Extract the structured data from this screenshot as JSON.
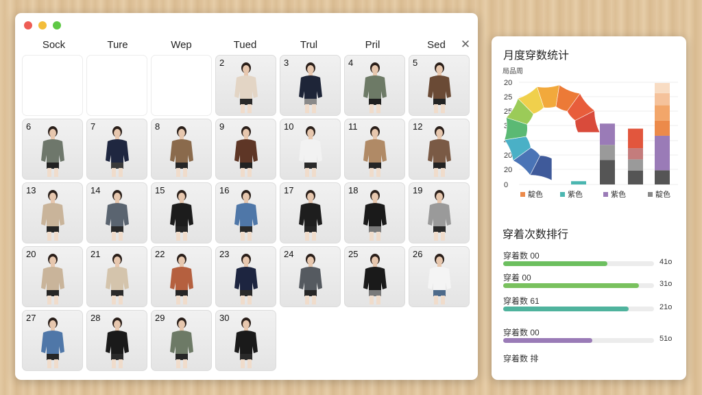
{
  "calendar": {
    "weekday_headers": [
      "Sock",
      "Ture",
      "Wep",
      "Tued",
      "Trul",
      "Pril",
      "Sed"
    ],
    "days": [
      {
        "day": "",
        "outfit": null
      },
      {
        "day": "",
        "outfit": null
      },
      {
        "day": "",
        "outfit": null
      },
      {
        "day": "2",
        "outfit": {
          "top": "#e3d5c5",
          "bottom": "#2a2a2a",
          "legs": "#f0dccb",
          "hair": "#2a1f1a"
        }
      },
      {
        "day": "3",
        "outfit": {
          "top": "#1e2538",
          "bottom": "#8a8a8a",
          "legs": "#f0dccb",
          "hair": "#2a1f1a"
        }
      },
      {
        "day": "4",
        "outfit": {
          "top": "#6d7a66",
          "bottom": "#1f1f1f",
          "legs": "#f0dccb",
          "hair": "#2a1f1a"
        }
      },
      {
        "day": "5",
        "outfit": {
          "top": "#6a4a35",
          "bottom": "#232323",
          "legs": "#f0dccb",
          "hair": "#2a1f1a"
        }
      },
      {
        "day": "6",
        "outfit": {
          "top": "#6e776b",
          "bottom": "#222222",
          "legs": "#f0dccb",
          "hair": "#2a1f1a"
        }
      },
      {
        "day": "7",
        "outfit": {
          "top": "#1f2740",
          "bottom": "#3a3a3a",
          "legs": "#f0dccb",
          "hair": "#2a1f1a"
        }
      },
      {
        "day": "8",
        "outfit": {
          "top": "#8a6a4c",
          "bottom": "#262626",
          "legs": "#f0dccb",
          "hair": "#2a1f1a"
        }
      },
      {
        "day": "9",
        "outfit": {
          "top": "#5e3626",
          "bottom": "#222222",
          "legs": "#f0dccb",
          "hair": "#2a1f1a"
        }
      },
      {
        "day": "10",
        "outfit": {
          "top": "#f2f2f2",
          "bottom": "#2a2a2a",
          "legs": "#f0dccb",
          "hair": "#2a1f1a"
        }
      },
      {
        "day": "11",
        "outfit": {
          "top": "#b08a66",
          "bottom": "#262626",
          "legs": "#f0dccb",
          "hair": "#2a1f1a"
        }
      },
      {
        "day": "12",
        "outfit": {
          "top": "#7a5a45",
          "bottom": "#222222",
          "legs": "#f0dccb",
          "hair": "#2a1f1a"
        }
      },
      {
        "day": "13",
        "outfit": {
          "top": "#c9b49a",
          "bottom": "#262626",
          "legs": "#f0dccb",
          "hair": "#2a1f1a"
        }
      },
      {
        "day": "14",
        "outfit": {
          "top": "#5a6470",
          "bottom": "#2a2a2a",
          "legs": "#f0dccb",
          "hair": "#2a1f1a"
        }
      },
      {
        "day": "15",
        "outfit": {
          "top": "#1c1c1c",
          "bottom": "#262626",
          "legs": "#f0dccb",
          "hair": "#2a1f1a"
        }
      },
      {
        "day": "16",
        "outfit": {
          "top": "#4f77a8",
          "bottom": "#2a2a2a",
          "legs": "#f0dccb",
          "hair": "#2a1f1a"
        }
      },
      {
        "day": "17",
        "outfit": {
          "top": "#1e1e1e",
          "bottom": "#262626",
          "legs": "#f0dccb",
          "hair": "#2a1f1a"
        }
      },
      {
        "day": "18",
        "outfit": {
          "top": "#1a1a1a",
          "bottom": "#7a7a7a",
          "legs": "#f0dccb",
          "hair": "#2a1f1a"
        }
      },
      {
        "day": "19",
        "outfit": {
          "top": "#9a9a9a",
          "bottom": "#2a2a2a",
          "legs": "#f0dccb",
          "hair": "#2a1f1a"
        }
      },
      {
        "day": "20",
        "outfit": {
          "top": "#c9b49a",
          "bottom": "#262626",
          "legs": "#f0dccb",
          "hair": "#2a1f1a"
        }
      },
      {
        "day": "21",
        "outfit": {
          "top": "#d4c4ac",
          "bottom": "#2a2a2a",
          "legs": "#f0dccb",
          "hair": "#2a1f1a"
        }
      },
      {
        "day": "22",
        "outfit": {
          "top": "#b5603f",
          "bottom": "#262626",
          "legs": "#f0dccb",
          "hair": "#2a1f1a"
        }
      },
      {
        "day": "23",
        "outfit": {
          "top": "#1d2540",
          "bottom": "#2a2a2a",
          "legs": "#f0dccb",
          "hair": "#2a1f1a"
        }
      },
      {
        "day": "24",
        "outfit": {
          "top": "#555a60",
          "bottom": "#262626",
          "legs": "#f0dccb",
          "hair": "#2a1f1a"
        }
      },
      {
        "day": "25",
        "outfit": {
          "top": "#1a1a1a",
          "bottom": "#7a7a7a",
          "legs": "#f0dccb",
          "hair": "#2a1f1a"
        }
      },
      {
        "day": "26",
        "outfit": {
          "top": "#f4f4f4",
          "bottom": "#4d6a8a",
          "legs": "#f0dccb",
          "hair": "#2a1f1a"
        }
      },
      {
        "day": "27",
        "outfit": {
          "top": "#4f77a8",
          "bottom": "#262626",
          "legs": "#f0dccb",
          "hair": "#2a1f1a"
        }
      },
      {
        "day": "28",
        "outfit": {
          "top": "#1a1a1a",
          "bottom": "#2a2a2a",
          "legs": "#f0dccb",
          "hair": "#2a1f1a"
        }
      },
      {
        "day": "29",
        "outfit": {
          "top": "#6d7a66",
          "bottom": "#262626",
          "legs": "#f0dccb",
          "hair": "#2a1f1a"
        }
      },
      {
        "day": "30",
        "outfit": {
          "top": "#1a1a1a",
          "bottom": "#2a2a2a",
          "legs": "#f0dccb",
          "hair": "#2a1f1a"
        }
      }
    ],
    "close_icon": "close-icon",
    "traffic_lights": [
      "#ee5d55",
      "#f3bd3a",
      "#5ec845"
    ]
  },
  "stats": {
    "title": "月度穿数统计",
    "chart_subtitle": "局品周",
    "chart_data": {
      "type": "bar",
      "y_ticks": [
        "20",
        "25",
        "25",
        "30",
        "40",
        "20",
        "20",
        "0"
      ],
      "legend": [
        {
          "label": "靛色",
          "color": "#ec8a4a"
        },
        {
          "label": "紫色",
          "color": "#4bb6b0"
        },
        {
          "label": "紫色",
          "color": "#9a7bb7"
        },
        {
          "label": "靛色",
          "color": "#8a8a8a"
        }
      ],
      "donut_colors": [
        "#3f5a9a",
        "#4a74b6",
        "#4ab0c6",
        "#5bb974",
        "#9bcb58",
        "#f0d04c",
        "#f2a93c",
        "#ec7a37",
        "#e85d3b",
        "#d94b3b"
      ],
      "bar_stacks": [
        {
          "segments": [
            {
              "color": "#4bb6b0",
              "h": 0.18
            }
          ]
        },
        {
          "segments": [
            {
              "color": "#555555",
              "h": 0.4
            },
            {
              "color": "#9a9a9a",
              "h": 0.25
            },
            {
              "color": "#9a7bb7",
              "h": 0.35
            }
          ]
        },
        {
          "segments": [
            {
              "color": "#555555",
              "h": 0.25
            },
            {
              "color": "#9a9a9a",
              "h": 0.2
            },
            {
              "color": "#c47c7c",
              "h": 0.2
            },
            {
              "color": "#e2563d",
              "h": 0.35
            }
          ]
        },
        {
          "segments": [
            {
              "color": "#555555",
              "h": 0.14
            },
            {
              "color": "#9a7bb7",
              "h": 0.34
            },
            {
              "color": "#ec8a4a",
              "h": 0.15
            },
            {
              "color": "#f2a66a",
              "h": 0.15
            },
            {
              "color": "#f5c29b",
              "h": 0.12
            },
            {
              "color": "#f8dcc3",
              "h": 0.1
            }
          ]
        }
      ],
      "bar_levels": [
        0.18,
        0.6,
        0.55,
        1.0
      ]
    },
    "ranking_title": "穿着次数排行",
    "ranking": [
      {
        "label": "穿着数 00",
        "value": "41o",
        "fill": 0.69,
        "color": "#6cbf5f"
      },
      {
        "label": "穿着 00",
        "value": "31o",
        "fill": 0.9,
        "color": "#79c15e"
      },
      {
        "label": "穿着数 61",
        "value": "21o",
        "fill": 0.83,
        "color": "#4fb39d"
      },
      {
        "label": "穿着数 00",
        "value": "51o",
        "fill": 0.59,
        "color": "#9a7bb7"
      },
      {
        "label": "穿着数 排",
        "value": "",
        "fill": 0,
        "color": "#cccccc"
      }
    ]
  }
}
